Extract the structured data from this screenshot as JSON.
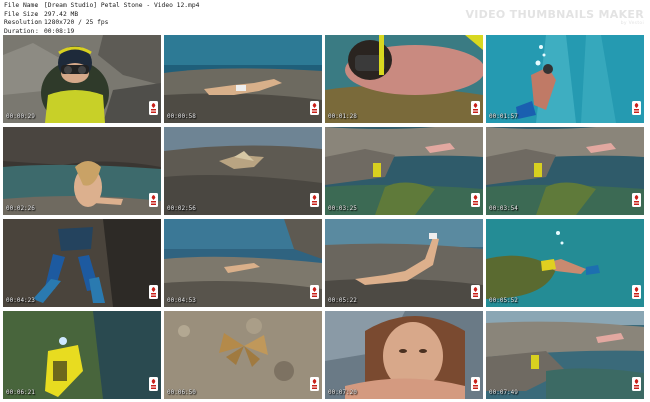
{
  "info": {
    "rows": [
      {
        "key": "File Name",
        "value": "[Dream Studio] Petal Stone - Video 12.mp4"
      },
      {
        "key": "File Size",
        "value": "297.42 MB"
      },
      {
        "key": "Resolution",
        "value": "1280x720 / 25 fps"
      },
      {
        "key": "Duration",
        "value": "00:08:19"
      }
    ],
    "separator": ":"
  },
  "brand": {
    "title": "VIDEO THUMBNAILS MAKER",
    "subtitle": "by Vestoi"
  },
  "thumbnails": [
    {
      "timestamp": "00:00:29",
      "scene": "diver-closeup"
    },
    {
      "timestamp": "00:00:58",
      "scene": "rock-lying"
    },
    {
      "timestamp": "00:01:28",
      "scene": "underwater-mask"
    },
    {
      "timestamp": "00:01:57",
      "scene": "underwater-blue"
    },
    {
      "timestamp": "00:02:26",
      "scene": "sitting-rock"
    },
    {
      "timestamp": "00:02:56",
      "scene": "rock-water"
    },
    {
      "timestamp": "00:03:25",
      "scene": "shore-rocks"
    },
    {
      "timestamp": "00:03:54",
      "scene": "shore-rocks"
    },
    {
      "timestamp": "00:04:23",
      "scene": "fins-rock"
    },
    {
      "timestamp": "00:04:53",
      "scene": "rock-lying-small"
    },
    {
      "timestamp": "00:05:22",
      "scene": "rock-lying-legs"
    },
    {
      "timestamp": "00:05:52",
      "scene": "underwater-swim"
    },
    {
      "timestamp": "00:06:21",
      "scene": "underwater-yellow"
    },
    {
      "timestamp": "00:06:50",
      "scene": "butterfly"
    },
    {
      "timestamp": "00:07:20",
      "scene": "face-closeup"
    },
    {
      "timestamp": "00:07:49",
      "scene": "shore-rocks-2"
    }
  ],
  "colors": {
    "logo_red": "#c8201a",
    "brand_gray": "#e3e3e3"
  }
}
